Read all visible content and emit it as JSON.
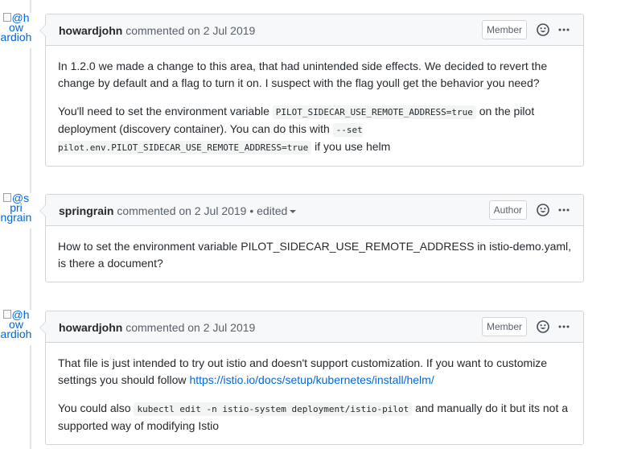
{
  "comments": [
    {
      "avatar_alt": [
        "@h",
        "ow",
        "ardioh"
      ],
      "author": "howardjohn",
      "action": "commented on 2 Jul 2019",
      "edited": "",
      "badge": "Member",
      "p1": "In 1.2.0 we made a change to this area, that had unintended side effects. We decided to revert the change by default and a flag to turn it on. I suspect with the flag youll get the behavior you need?",
      "p2_text1": "You'll need to set the environment variable ",
      "p2_code1": "PILOT_SIDECAR_USE_REMOTE_ADDRESS=true",
      "p2_text2": " on the pilot deployment (discovery container). You can do this with ",
      "p2_code2": "--set pilot.env.PILOT_SIDECAR_USE_REMOTE_ADDRESS=true",
      "p2_text3": " if you use helm"
    },
    {
      "avatar_alt": [
        "@s",
        "pri",
        "ngrain"
      ],
      "author": "springrain",
      "action": "commented on 2 Jul 2019",
      "edited": " • edited",
      "badge": "Author",
      "p1": "How to set the environment variable PILOT_SIDECAR_USE_REMOTE_ADDRESS in istio-demo.yaml, is there a document?"
    },
    {
      "avatar_alt": [
        "@h",
        "ow",
        "ardioh"
      ],
      "author": "howardjohn",
      "action": "commented on 2 Jul 2019",
      "edited": "",
      "badge": "Member",
      "p1_text": "That file is just intended to try out istio and doesn't support customization. If you want to customize settings you should follow ",
      "p1_link": "https://istio.io/docs/setup/kubernetes/install/helm/",
      "p2_text1": "You could also ",
      "p2_code": "kubectl edit -n istio-system deployment/istio-pilot",
      "p2_text2": " and manually do it but its not a supported way of modifying Istio"
    }
  ],
  "icons": {
    "reaction": "smiley-icon",
    "menu": "kebab-horizontal-icon"
  },
  "colors": {
    "link": "#0366d6",
    "header_bg": "#f6f8fa",
    "border": "#d1d5da"
  }
}
